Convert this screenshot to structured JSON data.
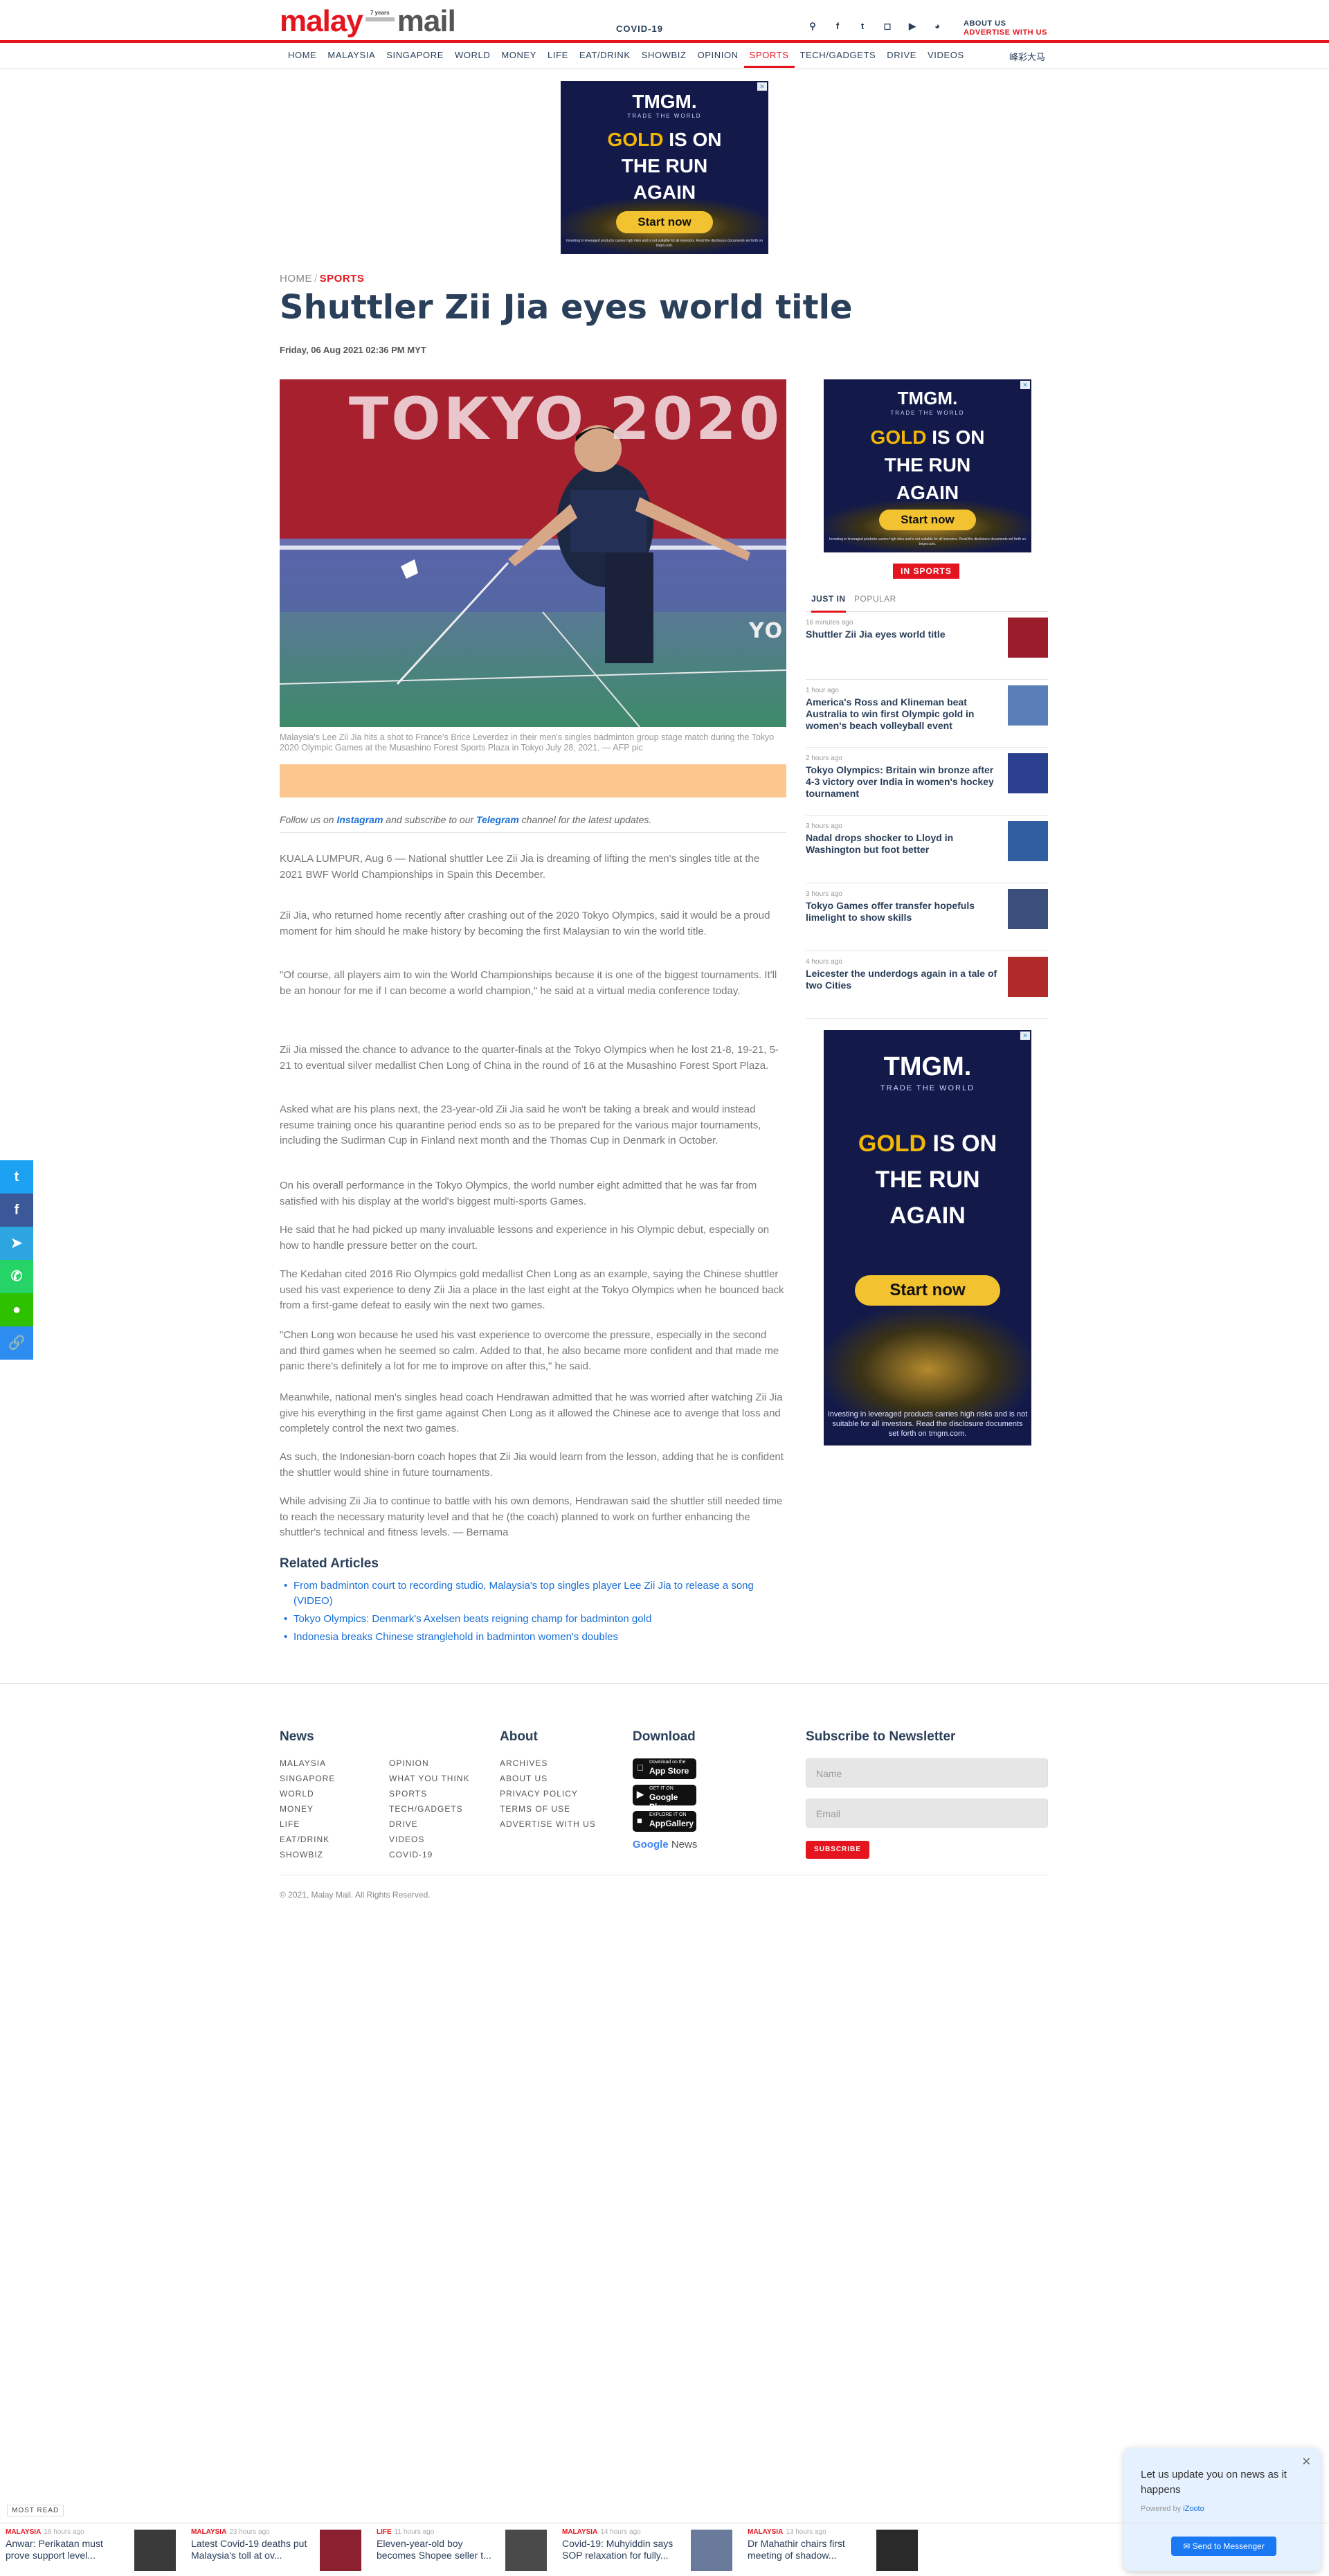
{
  "header": {
    "logo_left": "malay",
    "logo_years": "7 years",
    "logo_right": "mail",
    "covid_link": "COVID-19",
    "about": "ABOUT US",
    "advertise": "ADVERTISE WITH US",
    "icons": [
      "search-icon",
      "facebook-icon",
      "twitter-icon",
      "instagram-icon",
      "youtube-icon",
      "rss-icon"
    ]
  },
  "nav": {
    "items": [
      "HOME",
      "MALAYSIA",
      "SINGAPORE",
      "WORLD",
      "MONEY",
      "LIFE",
      "EAT/DRINK",
      "SHOWBIZ",
      "OPINION",
      "SPORTS",
      "TECH/GADGETS",
      "DRIVE",
      "VIDEOS"
    ],
    "active": "SPORTS",
    "chinese": "峰彩大马"
  },
  "ad": {
    "brand": "TMGM.",
    "tagline": "TRADE THE WORLD",
    "gold": "GOLD",
    "headline_rest": "IS ON",
    "headline_line2": "THE RUN",
    "headline_line3": "AGAIN",
    "button": "Start now",
    "fine_print": "Investing in leveraged products carries high risks and is not suitable for all investors. Read the disclosure documents set forth on tmgm.com."
  },
  "article": {
    "breadcrumb_home": "HOME",
    "breadcrumb_sep": "/",
    "breadcrumb_section": "SPORTS",
    "title": "Shuttler Zii Jia eyes world title",
    "date": "Friday, 06 Aug 2021 02:36 PM MYT",
    "hero_text": "TOKYO 2020",
    "hero_text_small": "YO",
    "caption": "Malaysia's Lee Zii Jia hits a shot to France's Brice Leverdez in their men's singles badminton group stage match during the Tokyo 2020 Olympic Games at the Musashino Forest Sports Plaza in Tokyo July 28, 2021. — AFP pic",
    "follow_pre": "Follow us on ",
    "follow_instagram": "Instagram",
    "follow_mid": " and subscribe to our ",
    "follow_telegram": "Telegram",
    "follow_post": " channel for the latest updates.",
    "paragraphs": [
      "KUALA LUMPUR, Aug 6 — National shuttler Lee Zii Jia is dreaming of lifting the men's singles title at the 2021 BWF World Championships in Spain this December.",
      "Zii Jia, who returned home recently after crashing out of the 2020 Tokyo Olympics, said it would be a proud moment for him should he make history by becoming the first Malaysian to win the world title.",
      "\"Of course, all players aim to win the World Championships because it is one of the biggest tournaments. It'll be an honour for me if I can become a world champion,\" he said at a virtual media conference today.",
      "Zii Jia missed the chance to advance to the quarter-finals at the Tokyo Olympics when he lost 21-8, 19-21, 5-21 to eventual silver medallist Chen Long of China in the round of 16 at the Musashino Forest Sport Plaza.",
      "Asked what are his plans next, the 23-year-old Zii Jia said he won't be taking a break and would instead resume training once his quarantine period ends so as to be prepared for the various major tournaments, including the Sudirman Cup in Finland next month and the Thomas Cup in Denmark in October.",
      "On his overall performance in the Tokyo Olympics, the world number eight admitted that he was far from satisfied with his display at the world's biggest multi-sports Games.",
      "He said that he had picked up many invaluable lessons and experience in his Olympic debut, especially on how to handle pressure better on the court.",
      "The Kedahan cited 2016 Rio Olympics gold medallist Chen Long as an example, saying the Chinese shuttler used his vast experience to deny Zii Jia a place in the last eight at the Tokyo Olympics when he bounced back from a first-game defeat to easily win the next two games.",
      "\"Chen Long won because he used his vast experience to overcome the pressure, especially in the second and third games when he seemed so calm. Added to that, he also became more confident and that made me panic there's definitely a lot for me to improve on after this,\" he said.",
      "Meanwhile, national men's singles head coach Hendrawan admitted that he was worried after watching Zii Jia give his everything in the first game against Chen Long as it allowed the Chinese ace to avenge that loss and completely control the next two games.",
      "As such, the Indonesian-born coach hopes that Zii Jia would learn from the lesson, adding that he is confident the shuttler would shine in future tournaments.",
      "While advising Zii Jia to continue to battle with his own demons, Hendrawan said the shuttler still needed time to reach the necessary maturity level and that he (the coach) planned to work on further enhancing the shuttler's technical and fitness levels. — Bernama"
    ]
  },
  "related": {
    "heading": "Related Articles",
    "items": [
      "From badminton court to recording studio, Malaysia's top singles player Lee Zii Jia to release a song (VIDEO)",
      "Tokyo Olympics: Denmark's Axelsen beats reigning champ for badminton gold",
      "Indonesia breaks Chinese stranglehold in badminton women's doubles"
    ]
  },
  "sidebar": {
    "section": "IN SPORTS",
    "tab_just_in": "JUST IN",
    "tab_popular": "POPULAR",
    "items": [
      {
        "ago": "16 minutes ago",
        "headline": "Shuttler Zii Jia eyes world title",
        "thumb": "#9b1c2a"
      },
      {
        "ago": "1 hour ago",
        "headline": "America's Ross and Klineman beat Australia to win first Olympic gold in women's beach volleyball event",
        "thumb": "#5a7fb8"
      },
      {
        "ago": "2 hours ago",
        "headline": "Tokyo Olympics: Britain win bronze after 4-3 victory over India in women's hockey tournament",
        "thumb": "#2b3f8f"
      },
      {
        "ago": "3 hours ago",
        "headline": "Nadal drops shocker to Lloyd in Washington but foot better",
        "thumb": "#2f5fa0"
      },
      {
        "ago": "3 hours ago",
        "headline": "Tokyo Games offer transfer hopefuls limelight to show skills",
        "thumb": "#3a4f7a"
      },
      {
        "ago": "4 hours ago",
        "headline": "Leicester the underdogs again in a tale of two Cities",
        "thumb": "#b02a2a"
      }
    ]
  },
  "footer": {
    "news_heading": "News",
    "news_col1": [
      "MALAYSIA",
      "SINGAPORE",
      "WORLD",
      "MONEY",
      "LIFE",
      "EAT/DRINK",
      "SHOWBIZ"
    ],
    "news_col2": [
      "OPINION",
      "WHAT YOU THINK",
      "SPORTS",
      "TECH/GADGETS",
      "DRIVE",
      "VIDEOS",
      "COVID-19"
    ],
    "about_heading": "About",
    "about_links": [
      "ARCHIVES",
      "ABOUT US",
      "PRIVACY POLICY",
      "TERMS OF USE",
      "ADVERTISE WITH US"
    ],
    "download_heading": "Download",
    "badges": [
      {
        "small": "Download on the",
        "big": "App Store",
        "icon": ""
      },
      {
        "small": "GET IT ON",
        "big": "Google Play",
        "icon": "▶"
      },
      {
        "small": "EXPLORE IT ON",
        "big": "AppGallery",
        "icon": "■"
      }
    ],
    "google": "Google",
    "news_word": "News",
    "newsletter_heading": "Subscribe to Newsletter",
    "name_placeholder": "Name",
    "email_placeholder": "Email",
    "subscribe": "SUBSCRIBE",
    "copyright": "© 2021, Malay Mail. All Rights Reserved."
  },
  "share": {
    "icons": [
      "twitter-icon",
      "facebook-icon",
      "telegram-icon",
      "whatsapp-icon",
      "wechat-icon",
      "link-icon"
    ],
    "colors": [
      "#1da1f2",
      "#3b5998",
      "#2ca5e0",
      "#25d366",
      "#2dc100",
      "#2d8cf0"
    ],
    "glyphs": [
      "t",
      "f",
      "➤",
      "✆",
      "●",
      "🔗"
    ]
  },
  "popup": {
    "message": "Let us update you on news as it happens",
    "powered_by": "Powered by",
    "powered_brand": "iZooto",
    "button": "Send to Messenger"
  },
  "most_read": {
    "label": "MOST READ",
    "items": [
      {
        "section": "MALAYSIA",
        "ago": "18 hours ago",
        "headline": "Anwar: Perikatan must prove support level...",
        "thumb": "#3a3a3a"
      },
      {
        "section": "MALAYSIA",
        "ago": "23 hours ago",
        "headline": "Latest Covid-19 deaths put Malaysia's toll at ov...",
        "thumb": "#8a2030"
      },
      {
        "section": "LIFE",
        "ago": "11 hours ago",
        "headline": "Eleven-year-old boy becomes Shopee seller t...",
        "thumb": "#4a4a4a"
      },
      {
        "section": "MALAYSIA",
        "ago": "14 hours ago",
        "headline": "Covid-19: Muhyiddin says SOP relaxation for fully...",
        "thumb": "#6a7a9a"
      },
      {
        "section": "MALAYSIA",
        "ago": "13 hours ago",
        "headline": "Dr Mahathir chairs first meeting of shadow...",
        "thumb": "#2a2a2a"
      }
    ]
  }
}
